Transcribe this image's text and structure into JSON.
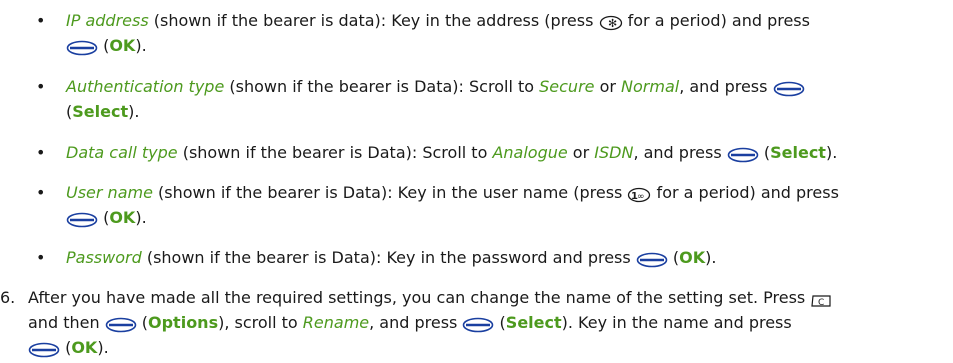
{
  "bullets": [
    {
      "term": "IP address",
      "t1": " (shown if the bearer is data): Key in the address (press ",
      "t2": " for a period) and press",
      "t3": " (",
      "key": "OK",
      "t4": ")."
    },
    {
      "term": "Authentication type",
      "t1": " (shown if the bearer is Data): Scroll to ",
      "opt1": "Secure",
      "t2": " or ",
      "opt2": "Normal",
      "t3": ", and press ",
      "t4": "(",
      "key": "Select",
      "t5": ")."
    },
    {
      "term": "Data call type",
      "t1": " (shown if the bearer is Data): Scroll to ",
      "opt1": "Analogue",
      "t2": " or ",
      "opt2": "ISDN",
      "t3": ", and press ",
      "t4": " (",
      "key": "Select",
      "t5": ")."
    },
    {
      "term": "User name",
      "t1": " (shown if the bearer is Data): Key in the user name (press ",
      "t2": " for a period) and press",
      "t3": " (",
      "key": "OK",
      "t4": ")."
    },
    {
      "term": "Password",
      "t1": " (shown if the bearer is Data): Key in the password and press ",
      "t2": " (",
      "key": "OK",
      "t3": ")."
    }
  ],
  "step6": {
    "number": "6.",
    "t1": "After you have made all the required settings, you can change the name of the setting set. Press ",
    "t2": "and then ",
    "t3": " (",
    "key1": "Options",
    "t4": "), scroll to ",
    "opt": "Rename",
    "t5": ", and press ",
    "t6": " (",
    "key2": "Select",
    "t7": "). Key in the name and press",
    "t8": " (",
    "key3": "OK",
    "t9": ")."
  },
  "icons": {
    "selection_key": "selection-key-icon",
    "star_key": "star-key-icon",
    "one_key": "one-key-icon",
    "clear_key": "clear-key-icon"
  },
  "colors": {
    "text": "#1a1a1a",
    "accent_green": "#4d9a1e",
    "key_blue": "#1a3fa0"
  }
}
